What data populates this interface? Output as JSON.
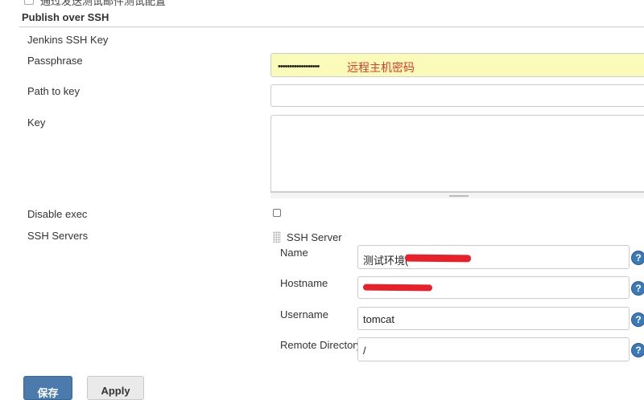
{
  "top_option_label": "通过发送测试邮件测试配置",
  "section": {
    "title": "Publish over SSH"
  },
  "fields": {
    "jenkins_ssh_key_label": "Jenkins SSH Key",
    "passphrase_label": "Passphrase",
    "passphrase_value": "••••••••••••••••••",
    "passphrase_annotation": "远程主机密码",
    "path_to_key_label": "Path to key",
    "path_to_key_value": "",
    "key_label": "Key",
    "key_value": "",
    "disable_exec_label": "Disable exec",
    "ssh_servers_label": "SSH Servers"
  },
  "ssh_server": {
    "header": "SSH Server",
    "name_label": "Name",
    "name_value": "测试环境(",
    "hostname_label": "Hostname",
    "hostname_value": "",
    "username_label": "Username",
    "username_value": "tomcat",
    "remote_dir_label": "Remote Directory",
    "remote_dir_value": "/"
  },
  "help_icon_glyph": "?",
  "buttons": {
    "save_label": "保存",
    "apply_label": "Apply"
  },
  "colors": {
    "annotation": "#e53a2b",
    "redaction": "#e8202a",
    "help_icon": "#3b79b7",
    "primary_button": "#4b7bac",
    "highlight_field": "#fbfbb9"
  }
}
